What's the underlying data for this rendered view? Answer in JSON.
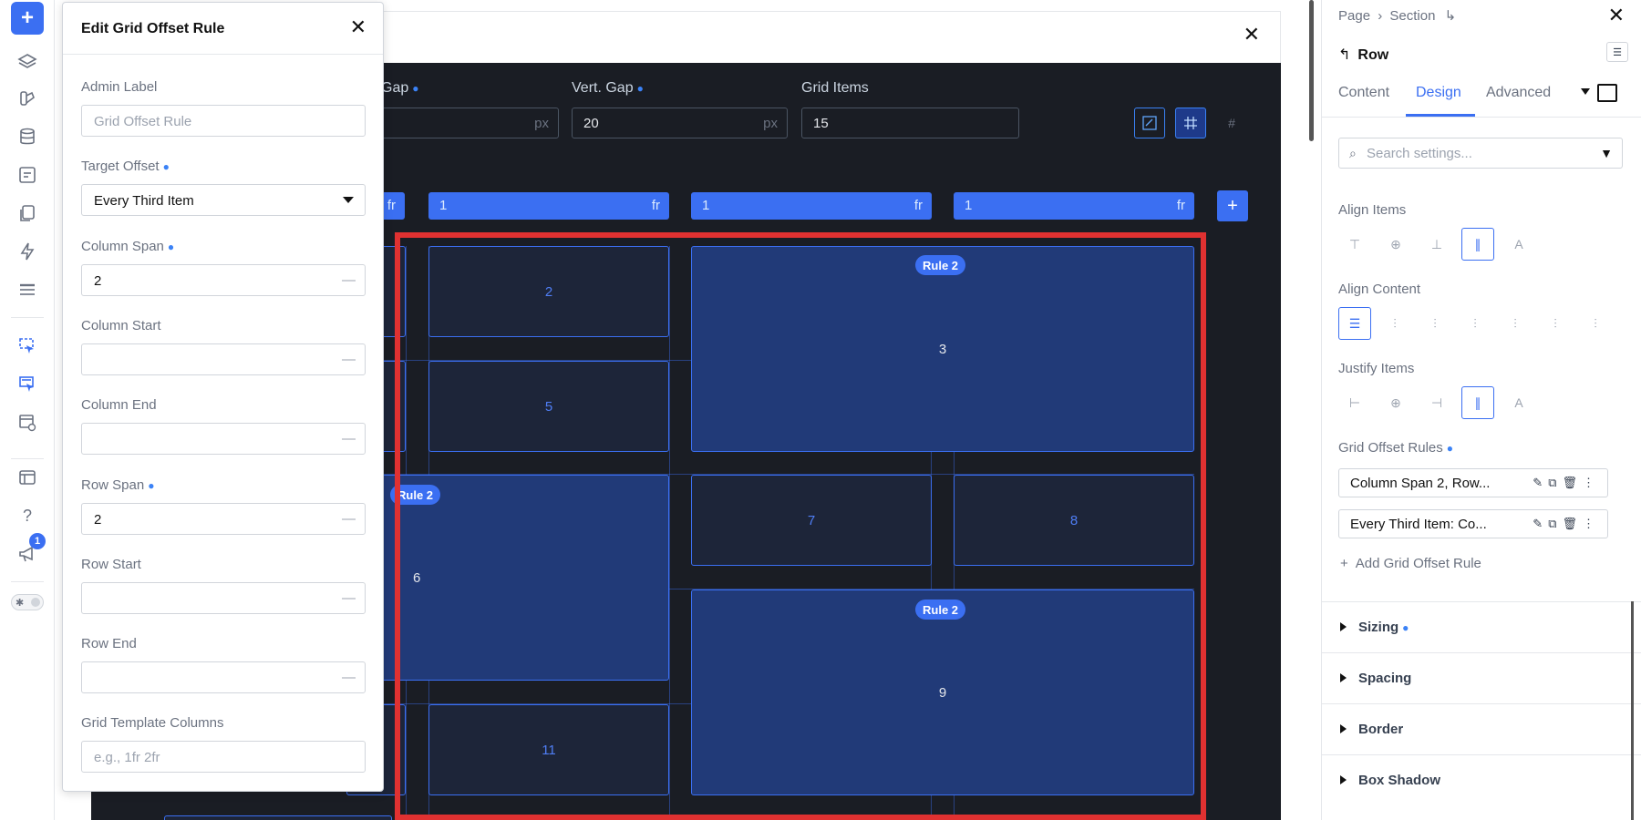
{
  "left_toolbar": {
    "items": [
      {
        "icon": "plus-icon"
      },
      {
        "icon": "layers-icon"
      },
      {
        "icon": "paint-icon"
      },
      {
        "icon": "database-icon"
      },
      {
        "icon": "form-icon"
      },
      {
        "icon": "pages-icon"
      },
      {
        "icon": "lightning-icon"
      },
      {
        "icon": "table-icon"
      },
      {
        "icon": "select-element-icon"
      },
      {
        "icon": "select-multi-icon"
      },
      {
        "icon": "template-preview-icon"
      },
      {
        "icon": "window-icon"
      },
      {
        "icon": "help-icon"
      },
      {
        "icon": "megaphone-icon"
      }
    ],
    "notification_count": "1"
  },
  "canvas": {
    "labels": {
      "horiz_gap": "Gap",
      "vert_gap": "Vert. Gap",
      "grid_items": "Grid Items"
    },
    "horiz_gap_unit": "px",
    "vert_gap_value": "20",
    "vert_gap_unit": "px",
    "grid_items_value": "15",
    "fr_unit": "fr",
    "columns": [
      {
        "value": "1"
      },
      {
        "value": "1"
      },
      {
        "value": "1"
      }
    ],
    "add_column_label": "+",
    "cells": [
      "2",
      "3",
      "5",
      "6",
      "7",
      "8",
      "9",
      "11"
    ],
    "rule_tags": [
      "Rule 2",
      "Rule 2",
      "Rule 2"
    ]
  },
  "edit_panel": {
    "title": "Edit Grid Offset Rule",
    "admin_label": {
      "label": "Admin Label",
      "placeholder": "Grid Offset Rule"
    },
    "target_offset": {
      "label": "Target Offset",
      "value": "Every Third Item"
    },
    "column_span": {
      "label": "Column Span",
      "value": "2"
    },
    "column_start": {
      "label": "Column Start",
      "value": ""
    },
    "column_end": {
      "label": "Column End",
      "value": ""
    },
    "row_span": {
      "label": "Row Span",
      "value": "2"
    },
    "row_start": {
      "label": "Row Start",
      "value": ""
    },
    "row_end": {
      "label": "Row End",
      "value": ""
    },
    "grid_template_columns": {
      "label": "Grid Template Columns",
      "placeholder": "e.g., 1fr 2fr"
    }
  },
  "right_panel": {
    "breadcrumb": [
      "Page",
      "Section"
    ],
    "element": "Row",
    "tabs": [
      "Content",
      "Design",
      "Advanced"
    ],
    "active_tab": "Design",
    "search_placeholder": "Search settings...",
    "align_items_label": "Align Items",
    "align_content_label": "Align Content",
    "justify_items_label": "Justify Items",
    "grid_offset_rules_label": "Grid Offset Rules",
    "rules": [
      "Column Span 2, Row...",
      "Every Third Item: Co..."
    ],
    "add_rule_label": "Add Grid Offset Rule",
    "sections": [
      "Sizing",
      "Spacing",
      "Border",
      "Box Shadow"
    ]
  },
  "colors": {
    "accent": "#3b6ff2",
    "canvas_bg": "#1a1d24",
    "highlight": "#e03131"
  }
}
